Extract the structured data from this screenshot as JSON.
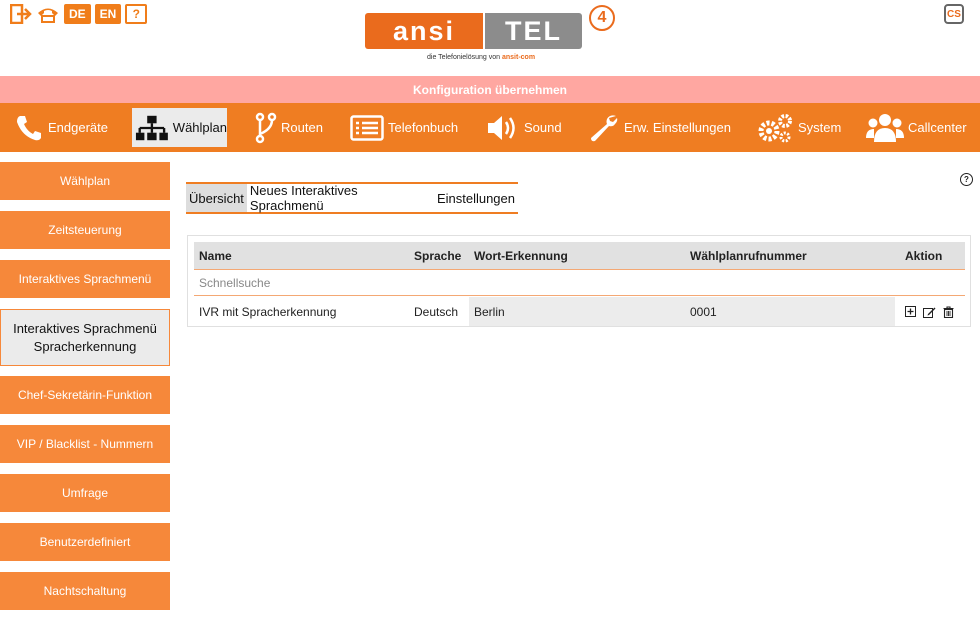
{
  "top": {
    "icons": [
      "logout-icon",
      "phone-hangup-icon",
      "flag-de-icon",
      "flag-en-icon",
      "help-icon"
    ],
    "lang_de": "DE",
    "lang_en": "EN",
    "help": "?",
    "logo": {
      "part1": "ansi",
      "part2": "TEL",
      "version": "4",
      "tagline_prefix": "die Telefonielösung von",
      "tagline_brand": "ansit-com"
    },
    "cs_label": "CS"
  },
  "config_bar": {
    "label": "Konfiguration übernehmen"
  },
  "nav": {
    "items": [
      {
        "label": "Endgeräte",
        "icon": "phone-icon"
      },
      {
        "label": "Wählplan",
        "icon": "sitemap-icon"
      },
      {
        "label": "Routen",
        "icon": "route-icon"
      },
      {
        "label": "Telefonbuch",
        "icon": "phonebook-icon"
      },
      {
        "label": "Sound",
        "icon": "speaker-icon"
      },
      {
        "label": "Erw. Einstellungen",
        "icon": "wrench-icon"
      },
      {
        "label": "System",
        "icon": "gears-icon"
      },
      {
        "label": "Callcenter",
        "icon": "users-icon"
      }
    ],
    "active": "Wählplan"
  },
  "sidebar": {
    "items": [
      {
        "label": "Wählplan"
      },
      {
        "label": "Zeitsteuerung"
      },
      {
        "label": "Interaktives Sprachmenü"
      },
      {
        "label": "Interaktives Sprachmenü Spracherkennung"
      },
      {
        "label": "Chef-Sekretärin-Funktion"
      },
      {
        "label": "VIP / Blacklist - Nummern"
      },
      {
        "label": "Umfrage"
      },
      {
        "label": "Benutzerdefiniert"
      },
      {
        "label": "Nachtschaltung"
      }
    ],
    "active": "Interaktives Sprachmenü Spracherkennung"
  },
  "tabs": {
    "items": [
      {
        "label": "Übersicht"
      },
      {
        "label": "Neues Interaktives Sprachmenü"
      },
      {
        "label": "Einstellungen"
      }
    ],
    "active": "Übersicht"
  },
  "table": {
    "columns": [
      "Name",
      "Sprache",
      "Wort-Erkennung",
      "Wählplanrufnummer",
      "Aktion"
    ],
    "quick_search_placeholder": "Schnellsuche",
    "rows": [
      {
        "name": "IVR mit Spracherkennung",
        "language": "Deutsch",
        "word": "Berlin",
        "number": "0001",
        "actions": [
          "add-icon",
          "edit-icon",
          "delete-icon"
        ]
      }
    ]
  },
  "colors": {
    "accent": "#ef7d22",
    "config_bar": "#ffa7a1",
    "active_bg": "#ebebeb"
  }
}
